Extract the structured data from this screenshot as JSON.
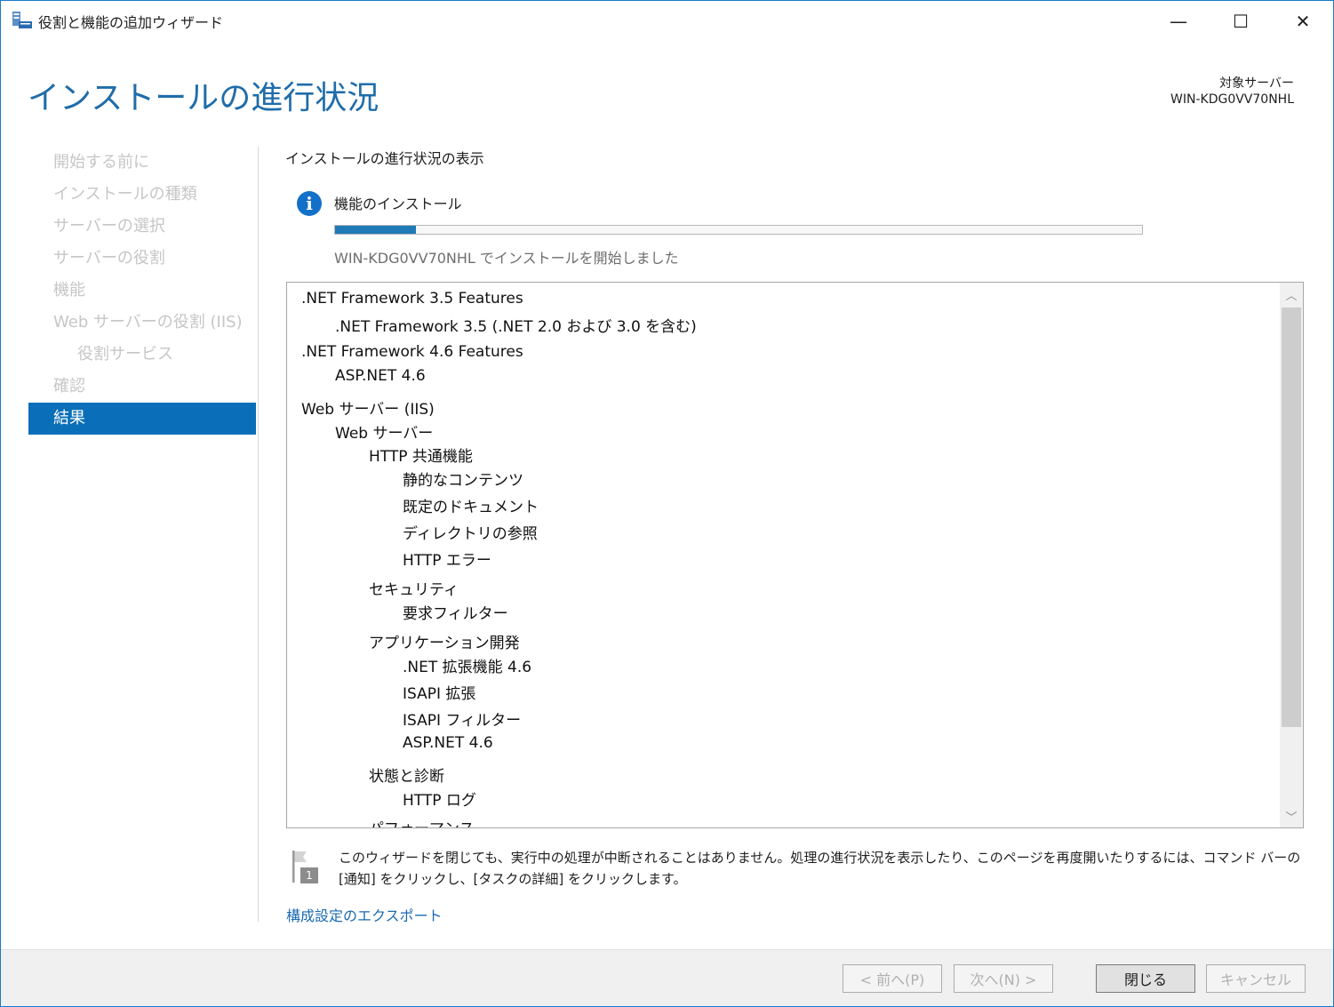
{
  "window": {
    "title": "役割と機能の追加ウィザード",
    "controls": {
      "minimize": "—",
      "maximize": "☐",
      "close": "✕"
    }
  },
  "header": {
    "page_title": "インストールの進行状況",
    "target_label": "対象サーバー",
    "target_server": "WIN-KDG0VV70NHL"
  },
  "nav": {
    "items": [
      {
        "label": "開始する前に",
        "state": "disabled"
      },
      {
        "label": "インストールの種類",
        "state": "disabled"
      },
      {
        "label": "サーバーの選択",
        "state": "disabled"
      },
      {
        "label": "サーバーの役割",
        "state": "disabled"
      },
      {
        "label": "機能",
        "state": "disabled"
      },
      {
        "label": "Web サーバーの役割 (IIS)",
        "state": "disabled"
      },
      {
        "label": "役割サービス",
        "state": "disabled"
      },
      {
        "label": "確認",
        "state": "disabled"
      },
      {
        "label": "結果",
        "state": "active"
      }
    ]
  },
  "content": {
    "section_title": "インストールの進行状況の表示",
    "feature_install": "機能のインストール",
    "progress_fraction": 0.1,
    "install_status": "WIN-KDG0VV70NHL でインストールを開始しました",
    "list": [
      ".NET Framework 3.5 Features",
      ".NET Framework 3.5 (.NET 2.0 および 3.0 を含む)",
      ".NET Framework 4.6 Features",
      "ASP.NET 4.6",
      "Web サーバー (IIS)",
      "Web サーバー",
      "HTTP 共通機能",
      "静的なコンテンツ",
      "既定のドキュメント",
      "ディレクトリの参照",
      "HTTP エラー",
      "セキュリティ",
      "要求フィルター",
      "アプリケーション開発",
      ".NET 拡張機能 4.6",
      "ISAPI 拡張",
      "ISAPI フィルター",
      "ASP.NET 4.6",
      "状態と診断",
      "HTTP ログ",
      "パフォーマンス"
    ],
    "notice": "このウィザードを閉じても、実行中の処理が中断されることはありません。処理の進行状況を表示したり、このページを再度開いたりするには、コマンド バーの [通知] をクリックし、[タスクの詳細] をクリックします。",
    "flag_badge": "1",
    "export_link": "構成設定のエクスポート"
  },
  "footer": {
    "prev": "< 前へ(P)",
    "next": "次へ(N) >",
    "close": "閉じる",
    "cancel": "キャンセル"
  },
  "colors": {
    "accent": "#0a6fb8",
    "title_blue": "#1f6daa",
    "progress": "#1f7ab7"
  }
}
